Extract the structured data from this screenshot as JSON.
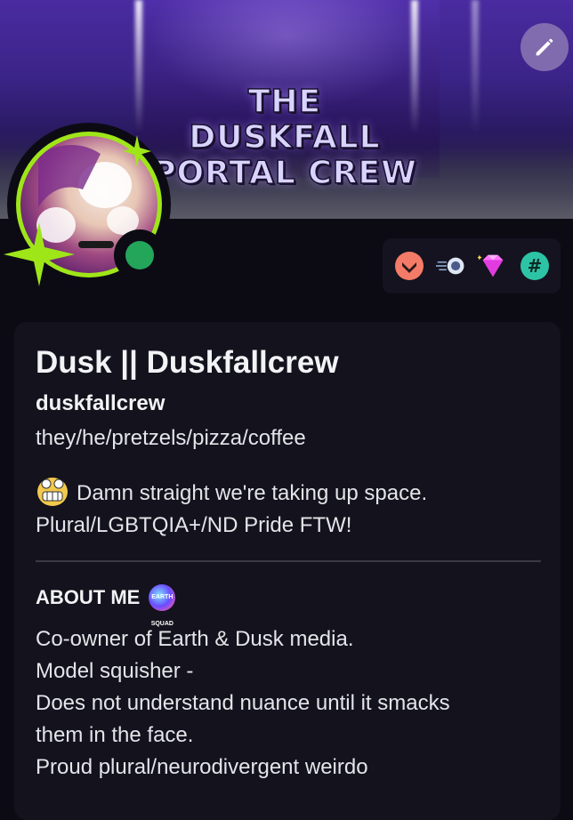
{
  "banner": {
    "title_line1": "THE DUSKFALL",
    "title_line2": "PORTAL CREW"
  },
  "profile": {
    "display_name": "Dusk || Duskfallcrew",
    "username": "duskfallcrew",
    "pronouns": "they/he/pretzels/pizza/coffee",
    "status_line1": "Damn straight we're taking up space.",
    "status_line2": "Plural/LGBTQIA+/ND Pride FTW!",
    "online_status": "online"
  },
  "badges": [
    {
      "icon": "hypesquad-brilliance-icon"
    },
    {
      "icon": "speed-orb-icon"
    },
    {
      "icon": "gem-icon"
    },
    {
      "icon": "hashtag-icon",
      "text": "#"
    }
  ],
  "about": {
    "title": "ABOUT ME",
    "icon_text": "EARTH SQUAD",
    "lines": [
      "Co-owner of Earth & Dusk media.",
      "Model squisher -",
      "Does not understand nuance until it smacks",
      "them in the face.",
      "Proud plural/neurodivergent weirdo"
    ]
  },
  "colors": {
    "accent_green": "#9fe619",
    "online": "#23a55a",
    "background": "#0c0b14"
  }
}
